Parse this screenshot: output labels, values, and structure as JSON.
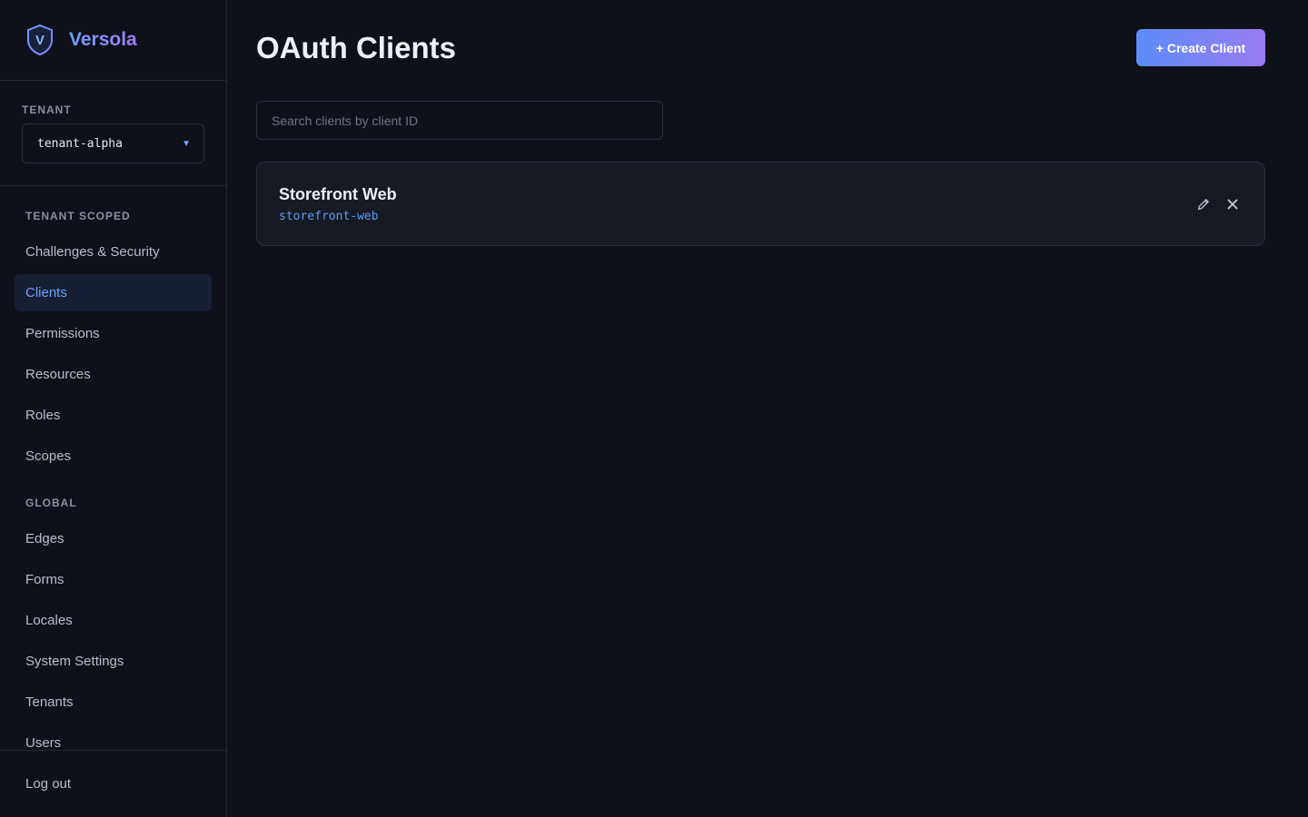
{
  "brand": {
    "name": "Versola",
    "logo_letter": "V"
  },
  "tenant": {
    "label": "TENANT",
    "value": "tenant-alpha"
  },
  "nav": {
    "groups": [
      {
        "label": "TENANT SCOPED",
        "items": [
          {
            "label": "Challenges & Security",
            "active": false
          },
          {
            "label": "Clients",
            "active": true
          },
          {
            "label": "Permissions",
            "active": false
          },
          {
            "label": "Resources",
            "active": false
          },
          {
            "label": "Roles",
            "active": false
          },
          {
            "label": "Scopes",
            "active": false
          }
        ]
      },
      {
        "label": "GLOBAL",
        "items": [
          {
            "label": "Edges",
            "active": false
          },
          {
            "label": "Forms",
            "active": false
          },
          {
            "label": "Locales",
            "active": false
          },
          {
            "label": "System Settings",
            "active": false
          },
          {
            "label": "Tenants",
            "active": false
          },
          {
            "label": "Users",
            "active": false
          }
        ]
      }
    ],
    "logout_label": "Log out"
  },
  "main": {
    "title": "OAuth Clients",
    "create_button_label": "+ Create Client",
    "search": {
      "placeholder": "Search clients by client ID",
      "value": ""
    },
    "clients": [
      {
        "name": "Storefront Web",
        "client_id": "storefront-web"
      }
    ]
  },
  "icons": {
    "logo": "shield-icon",
    "tenant_caret": "caret-down-icon",
    "edit": "pencil-icon",
    "delete": "close-icon"
  },
  "colors": {
    "background": "#0e111a",
    "accent": "#6fa0ff",
    "accent_secondary": "#a27cf5",
    "active_nav_bg": "#161f33"
  }
}
